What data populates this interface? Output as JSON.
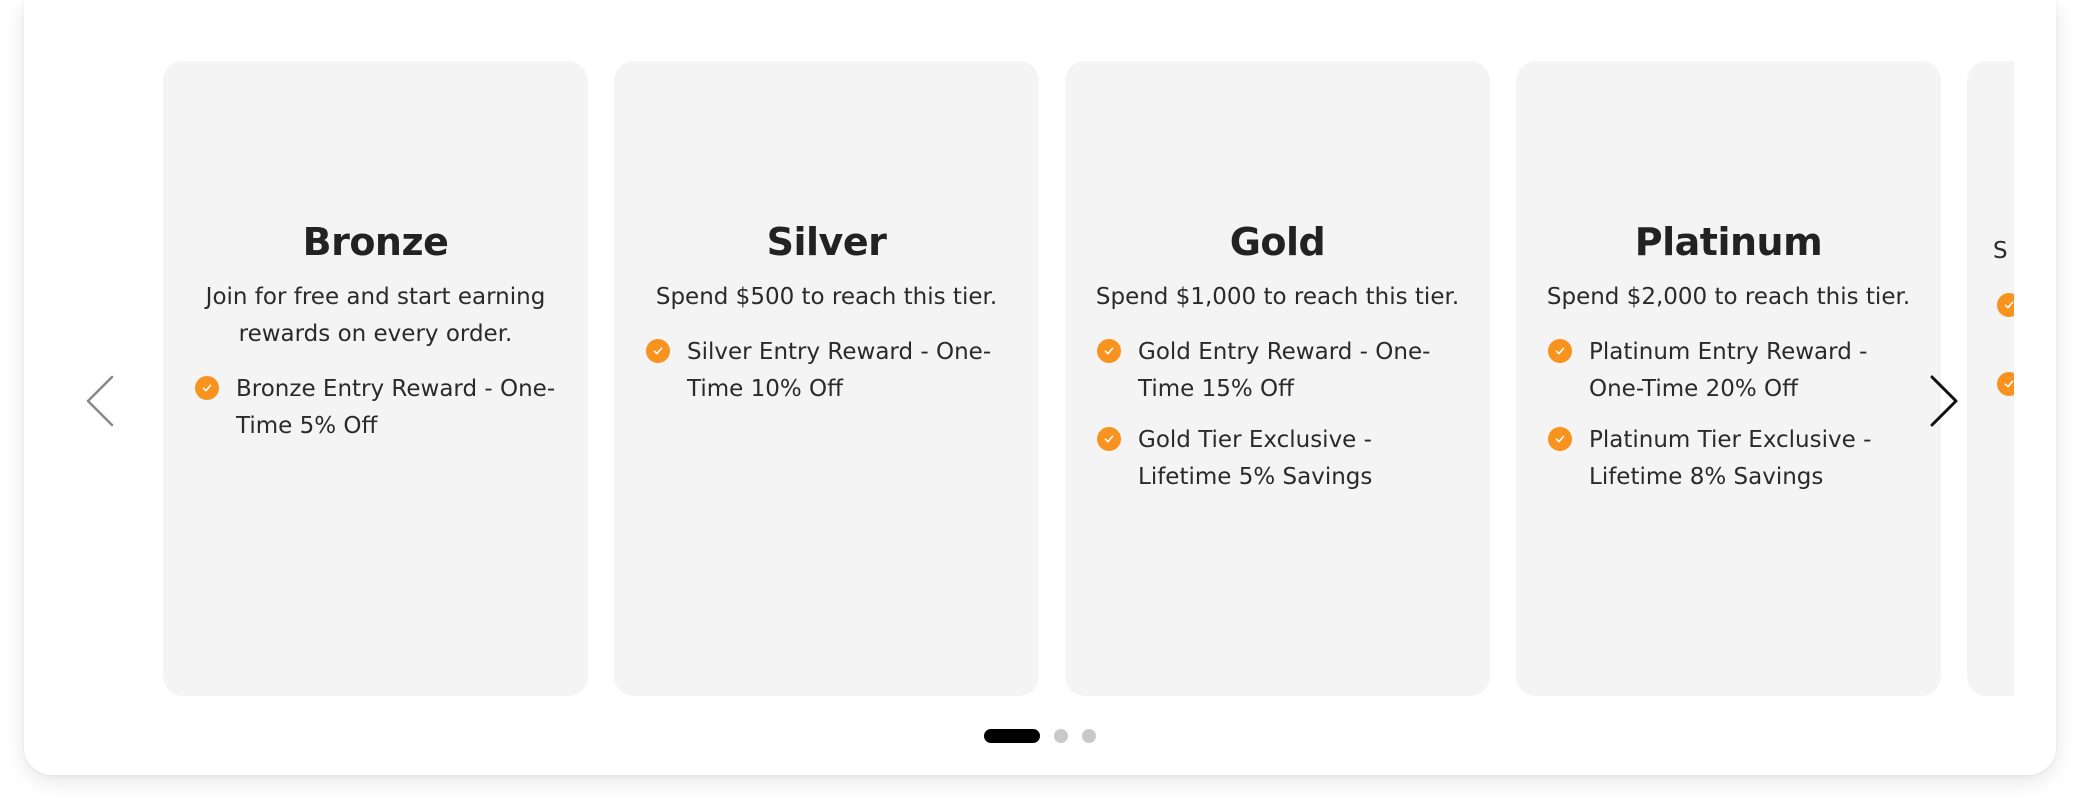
{
  "carousel": {
    "tiers": [
      {
        "title": "Bronze",
        "description": "Join for free and start earning rewards on every order.",
        "benefits": [
          "Bronze Entry Reward - One-Time 5% Off"
        ]
      },
      {
        "title": "Silver",
        "description": "Spend $500 to reach this tier.",
        "benefits": [
          "Silver Entry Reward - One-Time 10% Off"
        ]
      },
      {
        "title": "Gold",
        "description": "Spend $1,000 to reach this tier.",
        "benefits": [
          "Gold Entry Reward - One-Time 15% Off",
          "Gold Tier Exclusive - Lifetime 5% Savings"
        ]
      },
      {
        "title": "Platinum",
        "description": "Spend $2,000 to reach this tier.",
        "benefits": [
          "Platinum Entry Reward - One-Time 20% Off",
          "Platinum Tier Exclusive - Lifetime 8% Savings"
        ]
      },
      {
        "title": "",
        "description": "S",
        "benefits": [
          "",
          ""
        ]
      }
    ],
    "prev_icon": "chevron-left-icon",
    "next_icon": "chevron-right-icon",
    "check_icon": "check-circle-icon",
    "pagination": {
      "pages": 3,
      "active_index": 0
    }
  },
  "colors": {
    "accent": "#f7931e",
    "card_background": "#f4f4f4",
    "text": "#222222",
    "dot_active": "#000000",
    "dot_inactive": "#c9c9c9"
  }
}
